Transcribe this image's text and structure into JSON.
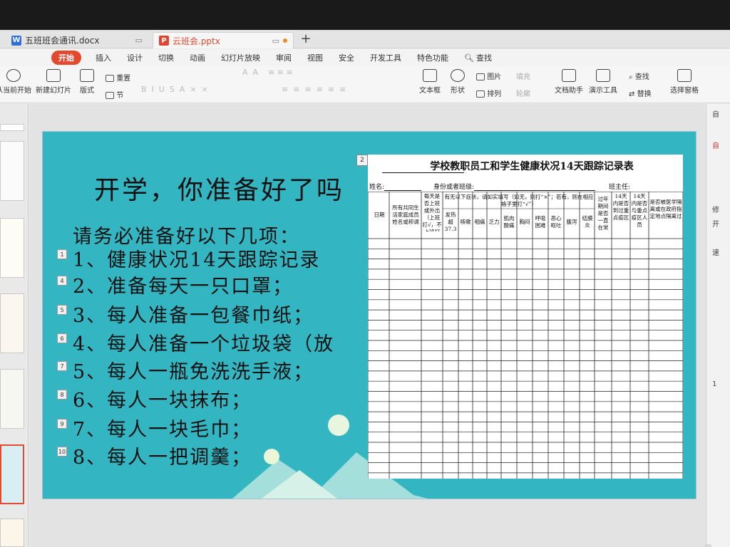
{
  "tabs": [
    {
      "label": "五班班会通讯.docx",
      "icon": "W"
    },
    {
      "label": "云班会.pptx",
      "icon": "P"
    }
  ],
  "menu": {
    "items": [
      "开始",
      "插入",
      "设计",
      "切换",
      "动画",
      "幻灯片放映",
      "审阅",
      "视图",
      "安全",
      "开发工具",
      "特色功能"
    ],
    "search": "查找"
  },
  "ribbon": {
    "from_start": "从当前开始",
    "new_slide": "新建幻灯片",
    "layout": "版式",
    "section": "节",
    "reset": "重置",
    "textbox": "文本框",
    "shape": "形状",
    "picture": "图片",
    "arrange": "排列",
    "fill": "填充",
    "outline": "轮廓",
    "doc_helper": "文档助手",
    "present_tool": "演示工具",
    "find": "查找",
    "replace": "替换",
    "select_pane": "选择窗格"
  },
  "slide": {
    "title": "开学，你准备好了吗",
    "subtitle": "请务必准备好以下几项：",
    "items": [
      {
        "num": "1",
        "text": "1、健康状况14天跟踪记录"
      },
      {
        "num": "4",
        "text": "2、准备每天一只口罩；"
      },
      {
        "num": "5",
        "text": "3、每人准备一包餐巾纸；"
      },
      {
        "num": "6",
        "text": "4、每人准备一个垃圾袋（放"
      },
      {
        "num": "7",
        "text": "5、每人一瓶免洗洗手液；"
      },
      {
        "num": "8",
        "text": "6、每人一块抹布；"
      },
      {
        "num": "9",
        "text": "7、每人一块毛巾；"
      },
      {
        "num": "10",
        "text": "8、每人一把调羹；"
      }
    ]
  },
  "form": {
    "badge": "2",
    "title": "学校教职员工和学生健康状况14天跟踪记录表",
    "name_label": "姓名:",
    "id_label": "身份或者班级:",
    "teacher_label": "班主任:",
    "headers": {
      "date": "日期",
      "family": "所有共同生活家庭成员姓名或称谓",
      "work": "每天是否上班或外出（上班打√，不上班打×）",
      "symptoms": "有无以下症状，请如实填写（如无，则打“×”；若有，则在相应格子里打“√”）",
      "fever": "发热超37.3",
      "cough": "咳嗽",
      "throat": "咽痛",
      "fatigue": "乏力",
      "muscle": "肌肉酸痛",
      "chest": "胸闷",
      "breath": "呼吸困难",
      "nausea": "恶心呕吐",
      "diarrhea": "腹泻",
      "conjunct": "结膜炎",
      "stay": "过年期间是否一直在常",
      "key_area": "14天内是否到过重点疫区",
      "contact": "14天内是否与重点疫区人员",
      "quarantine": "是否被医学隔离或在政府指定地点隔离过"
    }
  },
  "right_pane": [
    "自",
    "自",
    "修",
    "开",
    "速",
    "1"
  ],
  "colors": {
    "slide_bg": "#33b5c2",
    "accent": "#e2492f"
  }
}
